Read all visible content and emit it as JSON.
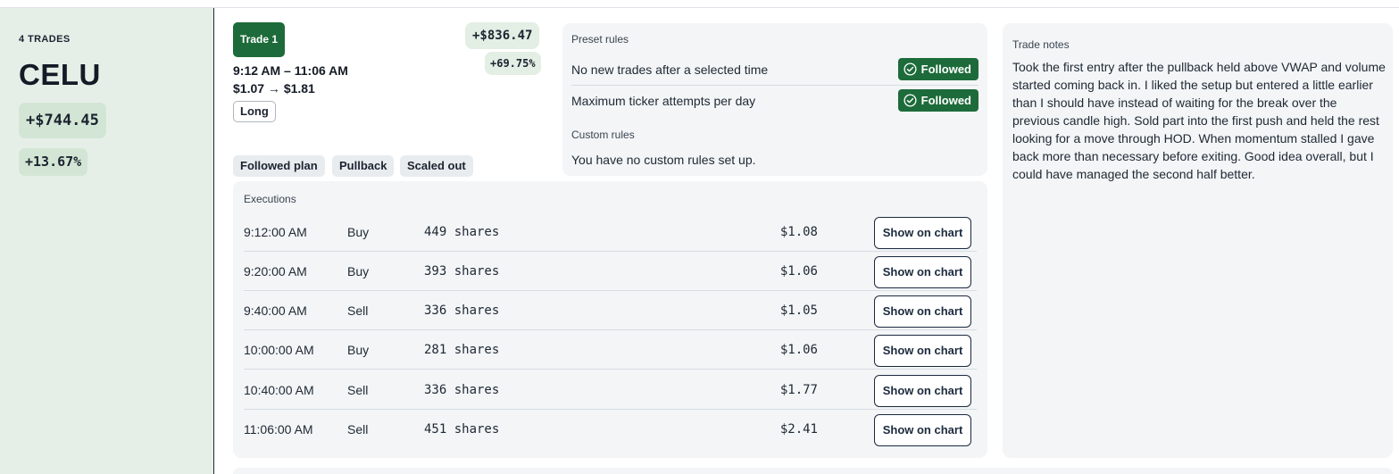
{
  "summary": {
    "trade_count": "4 TRADES",
    "ticker": "CELU",
    "pnl": "+$744.45",
    "pct": "+13.67%"
  },
  "trade": {
    "label": "Trade 1",
    "pnl": "+$836.47",
    "pct": "+69.75%",
    "time_range": "9:12 AM – 11:06 AM",
    "price_range": "$1.07 → $1.81",
    "side": "Long",
    "tags": [
      "Followed plan",
      "Pullback",
      "Scaled out"
    ]
  },
  "rules": {
    "preset_label": "Preset rules",
    "preset": [
      {
        "text": "No new trades after a selected time",
        "status": "Followed"
      },
      {
        "text": "Maximum ticker attempts per day",
        "status": "Followed"
      }
    ],
    "custom_label": "Custom rules",
    "custom_empty": "You have no custom rules set up."
  },
  "executions": {
    "label": "Executions",
    "button_label": "Show on chart",
    "rows": [
      {
        "time": "9:12:00 AM",
        "side": "Buy",
        "shares": "449 shares",
        "price": "$1.08"
      },
      {
        "time": "9:20:00 AM",
        "side": "Buy",
        "shares": "393 shares",
        "price": "$1.06"
      },
      {
        "time": "9:40:00 AM",
        "side": "Sell",
        "shares": "336 shares",
        "price": "$1.05"
      },
      {
        "time": "10:00:00 AM",
        "side": "Buy",
        "shares": "281 shares",
        "price": "$1.06"
      },
      {
        "time": "10:40:00 AM",
        "side": "Sell",
        "shares": "336 shares",
        "price": "$1.77"
      },
      {
        "time": "11:06:00 AM",
        "side": "Sell",
        "shares": "451 shares",
        "price": "$2.41"
      }
    ]
  },
  "notes": {
    "label": "Trade notes",
    "text": "Took the first entry after the pullback held above VWAP and volume started coming back in. I liked the setup but entered a little earlier than I should have instead of waiting for the break over the previous candle high. Sold part into the first push and held the rest looking for a move through HOD. When momentum stalled I gave back more than necessary before exiting. Good idea overall, but I could have managed the second half better."
  },
  "colors": {
    "accent_green": "#1d6b3a",
    "summary_bg": "#e6efe7",
    "panel_bg": "#f3f5f7"
  },
  "icons": {
    "followed": "check-circle-icon"
  }
}
